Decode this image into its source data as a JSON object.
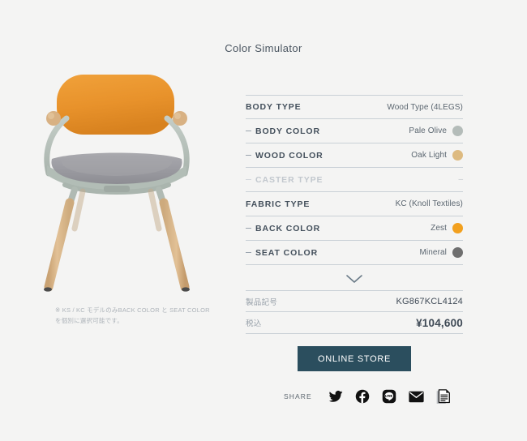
{
  "page": {
    "title": "Color Simulator",
    "background": "#f4f4f3"
  },
  "product_image": {
    "alt_name": "chair-preview",
    "back_color_hex": "#e8922b",
    "seat_color_hex": "#9a9a9f",
    "frame_color_hex": "#b7c1bb",
    "wood_color_hex": "#dbb98c",
    "armcap_color_hex": "#d8b183"
  },
  "note": {
    "line1": "※ KS / KC モデルのみBACK COLOR と SEAT COLOR",
    "line2": "を個別に選択可能です。"
  },
  "spec_table": {
    "rows": [
      {
        "label": "BODY TYPE",
        "value": "Wood Type (4LEGS)",
        "sub": false,
        "disabled": false,
        "swatch": null
      },
      {
        "label": "BODY COLOR",
        "value": "Pale Olive",
        "sub": true,
        "disabled": false,
        "swatch": "#b4bcb9"
      },
      {
        "label": "WOOD COLOR",
        "value": "Oak Light",
        "sub": true,
        "disabled": false,
        "swatch": "#ddba80"
      },
      {
        "label": "CASTER TYPE",
        "value": "",
        "sub": true,
        "disabled": true,
        "swatch": null,
        "placeholder": "–"
      },
      {
        "label": "FABRIC TYPE",
        "value": "KC (Knoll Textiles)",
        "sub": false,
        "disabled": false,
        "swatch": null
      },
      {
        "label": "BACK COLOR",
        "value": "Zest",
        "sub": true,
        "disabled": false,
        "swatch": "#f2a01e"
      },
      {
        "label": "SEAT COLOR",
        "value": "Mineral",
        "sub": true,
        "disabled": false,
        "swatch": "#6f6f6f"
      }
    ]
  },
  "expand_toggle": {
    "icon": "chevron-down-icon"
  },
  "summary_table": {
    "rows": [
      {
        "label": "製品記号",
        "value": "KG867KCL4124",
        "emphasis": false
      },
      {
        "label": "税込",
        "value": "¥104,600",
        "emphasis": true
      }
    ]
  },
  "store_button": {
    "label": "ONLINE STORE",
    "color": "#2b4e5e"
  },
  "share": {
    "label": "SHARE",
    "icons": [
      {
        "name": "twitter-icon",
        "title": "Twitter"
      },
      {
        "name": "facebook-icon",
        "title": "Facebook"
      },
      {
        "name": "line-icon",
        "title": "LINE"
      },
      {
        "name": "email-icon",
        "title": "Email"
      },
      {
        "name": "copy-document-icon",
        "title": "Copy"
      }
    ]
  }
}
